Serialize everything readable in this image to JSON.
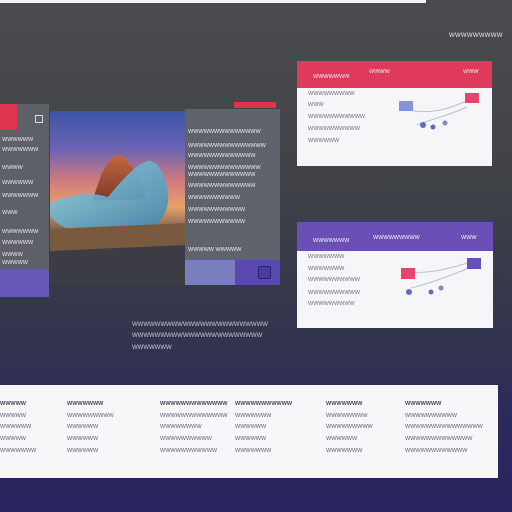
{
  "header": {
    "label": "WWWWWWWWW"
  },
  "left_panel": {
    "lines": [
      "WWWWWW",
      "WWWWWWW",
      "WWWW",
      "WWWWWW",
      "WWWWWWW",
      "WWW",
      "WWWWWWW",
      "WWWWWW",
      "WWWW",
      "WWWWW"
    ]
  },
  "hero_image": {
    "alt": "mountain landscape"
  },
  "mid_panel": {
    "lines": [
      "WWWWWWWWWWWWWW",
      "WWWWWWWWWWWWWWW",
      "WWWWWWWWWWWWW",
      "WWWWWWWWWWWWWW",
      "WWWWWWWWWWWWW",
      "WWWWWWWWWWWWW",
      "WWWWWWWWWW",
      "WWWWWWWWWWW",
      "WWWWWWWWWWW",
      "WWWWW WWWWW"
    ]
  },
  "card1": {
    "title": "WWWWWWW",
    "mid": "WWWW",
    "right": "WWW",
    "lines": [
      "WWWWWWWWW",
      "WWW",
      "WWWWWWWWWWW",
      "WWWWWWWWWW",
      "WWWWWW"
    ]
  },
  "card2": {
    "title": "WWWWWWW",
    "mid": "WWWWWWWWW",
    "right": "WWW",
    "lines": [
      "WWWWWWW",
      "WWWWWWW",
      "WWWWWWWWWW",
      "WWWWWWWWWW",
      "WWWWWWWWW"
    ]
  },
  "caption": {
    "lines": [
      "WWWWWWWWWWWWWWWWWWWWWWWW",
      "WWWWWWWWWWWWWWWWWWWWWWW",
      "WWWWWWW"
    ]
  },
  "table": {
    "columns": [
      {
        "header": "WWWWW",
        "cells": [
          "WWWWW",
          "WWWWWW",
          "WWWWW",
          "WWWWWWW"
        ]
      },
      {
        "header": "WWWWWWW",
        "cells": [
          "WWWWWWWWW",
          "WWWWWW",
          "WWWWWW",
          "WWWWWW"
        ]
      },
      {
        "header": "WWWWWWWWWWWWW",
        "cells": [
          "WWWWWWWWWWWWW",
          "WWWWWWWW",
          "WWWWWWWWWW",
          "WWWWWWWWWWW"
        ]
      },
      {
        "header": "WWWWWWWWWWW",
        "cells": [
          "WWWWWWW",
          "WWWWWW",
          "WWWWWW",
          "WWWWWWW"
        ]
      },
      {
        "header": "WWWWWWW",
        "cells": [
          "WWWWWWWW",
          "WWWWWWWWW",
          "WWWWWW",
          "WWWWWWW"
        ]
      },
      {
        "header": "WWWWWWW",
        "cells": [
          "WWWWWWWWWW",
          "WWWWWWWWWWWWWWW",
          "WWWWWWWWWWWWW",
          "WWWWWWWWWWWW"
        ]
      }
    ]
  },
  "colors": {
    "accent_red": "#df3a5c",
    "accent_purple": "#6a4fb6",
    "tile_violet": "#5848b0"
  }
}
